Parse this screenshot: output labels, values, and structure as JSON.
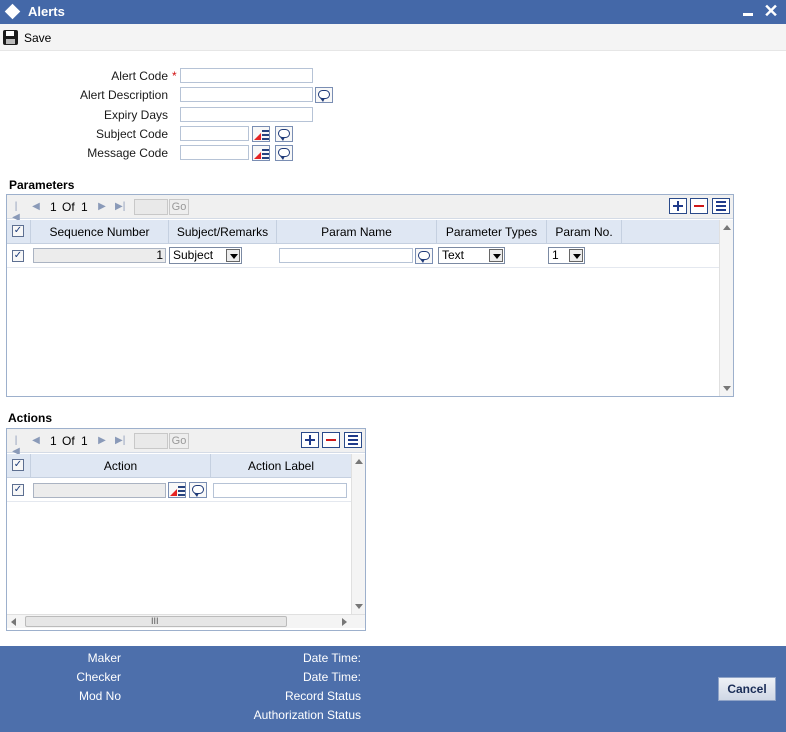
{
  "window": {
    "title": "Alerts"
  },
  "toolbar": {
    "save_label": "Save"
  },
  "form": {
    "alert_code_label": "Alert Code",
    "required_mark": "*",
    "alert_description_label": "Alert Description",
    "expiry_days_label": "Expiry Days",
    "subject_code_label": "Subject Code",
    "message_code_label": "Message Code"
  },
  "parameters": {
    "section_title": "Parameters",
    "pager": {
      "current": "1",
      "of_label": "Of",
      "total": "1",
      "go_label": "Go"
    },
    "columns": [
      "Sequence Number",
      "Subject/Remarks",
      "Param Name",
      "Parameter Types",
      "Param No."
    ],
    "rows": [
      {
        "sequence": "1",
        "subject_remarks": "Subject",
        "param_name": "",
        "parameter_type": "Text",
        "param_no": "1"
      }
    ]
  },
  "actions": {
    "section_title": "Actions",
    "pager": {
      "current": "1",
      "of_label": "Of",
      "total": "1",
      "go_label": "Go"
    },
    "columns": [
      "Action",
      "Action Label"
    ],
    "scroll_grip": "III"
  },
  "footer": {
    "maker_label": "Maker",
    "checker_label": "Checker",
    "mod_no_label": "Mod No",
    "date_time_label": "Date Time:",
    "record_status_label": "Record Status",
    "authorization_status_label": "Authorization Status",
    "cancel_label": "Cancel"
  }
}
